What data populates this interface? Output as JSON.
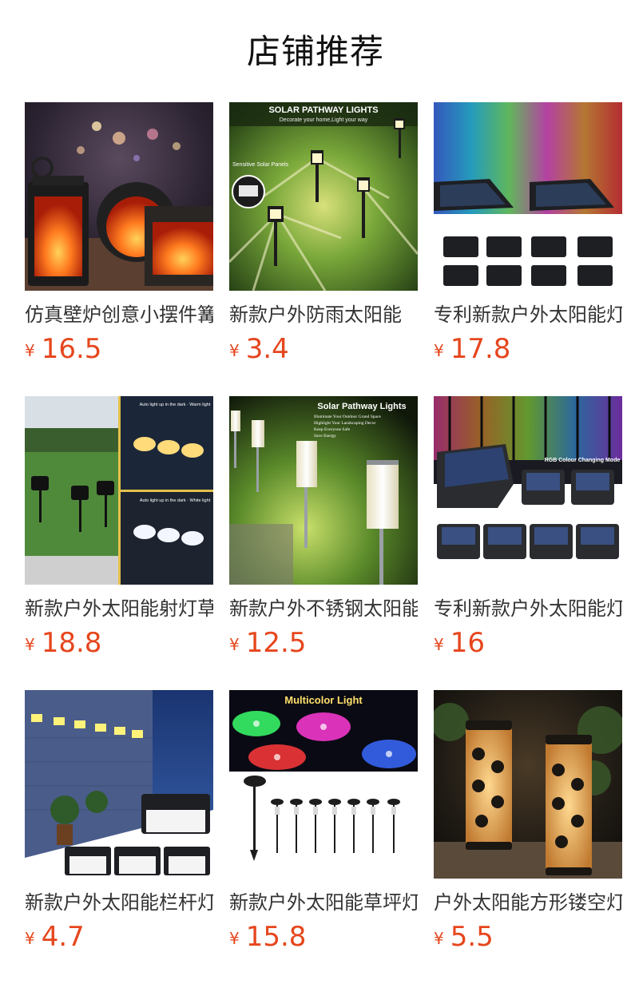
{
  "section": {
    "title": "店铺推荐"
  },
  "currency_symbol": "¥",
  "products": [
    {
      "name": "仿真壁炉创意小摆件篝火灯",
      "price": "16.5",
      "image_name": "fireplace-lanterns-image"
    },
    {
      "name": "新款户外防雨太阳能",
      "price": "3.4",
      "image_name": "solar-pathway-lights-image",
      "image_text": {
        "headline": "SOLAR PATHWAY LIGHTS",
        "subline": "Decorate your home,Light your way",
        "callout": "Sensitive Solar Panels"
      }
    },
    {
      "name": "专利新款户外太阳能灯",
      "price": "17.8",
      "image_name": "rgb-fence-lights-image"
    },
    {
      "name": "新款户外太阳能射灯草坪",
      "price": "18.8",
      "image_name": "solar-spotlights-image",
      "image_text": {
        "tag_warm": "Auto light up in the dark · Warm light",
        "tag_white": "Auto light up in the dark · White light"
      }
    },
    {
      "name": "新款户外不锈钢太阳能",
      "price": "12.5",
      "image_name": "stainless-pathway-lights-image",
      "image_text": {
        "headline": "Solar Pathway Lights",
        "lines": [
          "Illuminate Your Outdoor Grand Space",
          "Highlight Your Landscaping Decor",
          "Keep Everyone Safe",
          "Save Energy"
        ]
      }
    },
    {
      "name": "专利新款户外太阳能灯",
      "price": "16",
      "image_name": "rgb-step-lights-image",
      "image_text": {
        "headline": "RGB Colour Changing Mode"
      }
    },
    {
      "name": "新款户外太阳能栏杆灯",
      "price": "4.7",
      "image_name": "wall-fence-lights-image"
    },
    {
      "name": "新款户外太阳能草坪灯",
      "price": "15.8",
      "image_name": "multicolor-lawn-lights-image",
      "image_text": {
        "headline": "Multicolor Light"
      }
    },
    {
      "name": "户外太阳能方形镂空灯",
      "price": "5.5",
      "image_name": "hollow-lanterns-image"
    }
  ]
}
